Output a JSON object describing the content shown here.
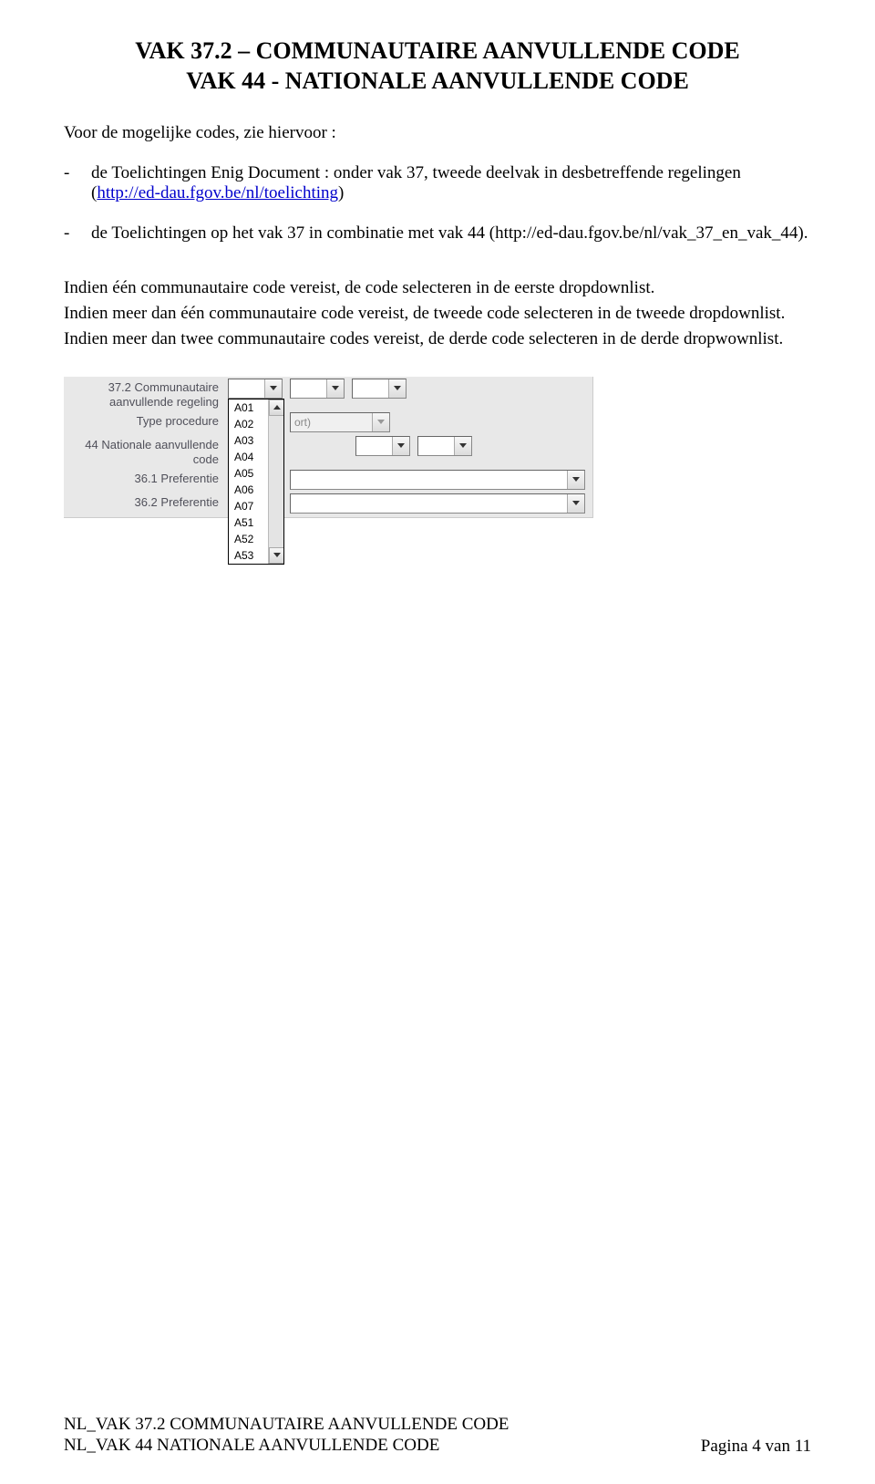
{
  "title": {
    "line1": "VAK 37.2 – COMMUNAUTAIRE AANVULLENDE CODE",
    "line2": "VAK 44 -  NATIONALE AANVULLENDE CODE"
  },
  "intro": "Voor de mogelijke codes, zie hiervoor :",
  "bullets": [
    {
      "dash": "-",
      "prefix": "de Toelichtingen Enig Document : onder vak 37, tweede deelvak in desbetreffende regelingen (",
      "link": "http://ed-dau.fgov.be/nl/toelichting",
      "suffix": ")"
    },
    {
      "dash": "-",
      "prefix": "de Toelichtingen op het vak 37 in combinatie met vak 44 (http://ed-dau.fgov.be/nl/vak_37_en_vak_44).",
      "link": "",
      "suffix": ""
    }
  ],
  "paras": {
    "p1": "Indien één communautaire code vereist, de code selecteren in de eerste dropdownlist.",
    "p2": "Indien meer dan één communautaire code vereist, de tweede code selecteren in de tweede dropdownlist.",
    "p3": "Indien meer dan twee communautaire codes vereist, de derde code selecteren in de derde dropwownlist."
  },
  "form": {
    "rows": {
      "r1": {
        "label": "37.2 Communautaire aanvullende regeling"
      },
      "r2": {
        "label": "Type procedure",
        "disabled_text": "ort)"
      },
      "r3": {
        "label": "44 Nationale aanvullende code"
      },
      "r4": {
        "label": "36.1 Preferentie"
      },
      "r5": {
        "label": "36.2 Preferentie"
      }
    },
    "dropdown": {
      "selected": "",
      "options": [
        "A01",
        "A02",
        "A03",
        "A04",
        "A05",
        "A06",
        "A07",
        "A51",
        "A52",
        "A53"
      ]
    }
  },
  "footer": {
    "left1": "NL_VAK 37.2 COMMUNAUTAIRE AANVULLENDE CODE",
    "left2": "NL_VAK 44 NATIONALE AANVULLENDE CODE",
    "right": "Pagina 4 van 11"
  }
}
